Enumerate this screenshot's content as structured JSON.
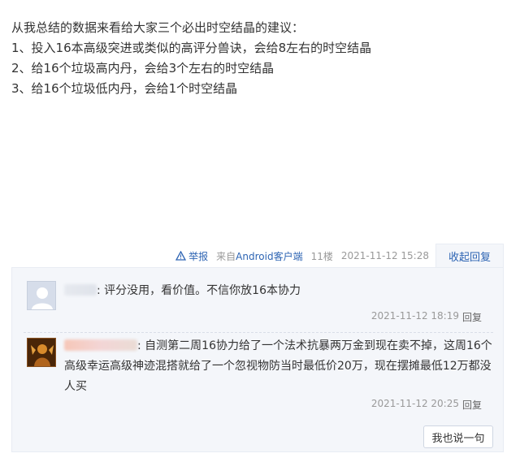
{
  "post": {
    "lines": [
      "从我总结的数据来看给大家三个必出时空结晶的建议：",
      "1、投入16本高级突进或类似的高评分兽诀，会给8左右的时空结晶",
      "2、给16个垃圾高内丹，会给3个左右的时空结晶",
      "3、给16个垃圾低内丹，会给1个时空结晶"
    ]
  },
  "meta": {
    "report_label": "举报",
    "source_prefix": "来自",
    "source_link": "Android客户端",
    "floor": "11楼",
    "timestamp": "2021-11-12 15:28",
    "collapse_label": "收起回复"
  },
  "replies": [
    {
      "text": ": 评分没用，看价值。不信你放16本协力",
      "time": "2021-11-12 18:19",
      "reply_label": "回复"
    },
    {
      "text": ": 自测第二周16协力给了一个法术抗暴两万金到现在卖不掉，这周16个高级幸运高级神迹混搭就给了一个忽视物防当时最低价20万，现在摆摊最低12万都没人买",
      "time": "2021-11-12 20:25",
      "reply_label": "回复"
    }
  ],
  "say_button_label": "我也说一句",
  "colors": {
    "link": "#2d64b3",
    "reply_bg": "#f4f6fa",
    "meta_gray": "#999999"
  }
}
